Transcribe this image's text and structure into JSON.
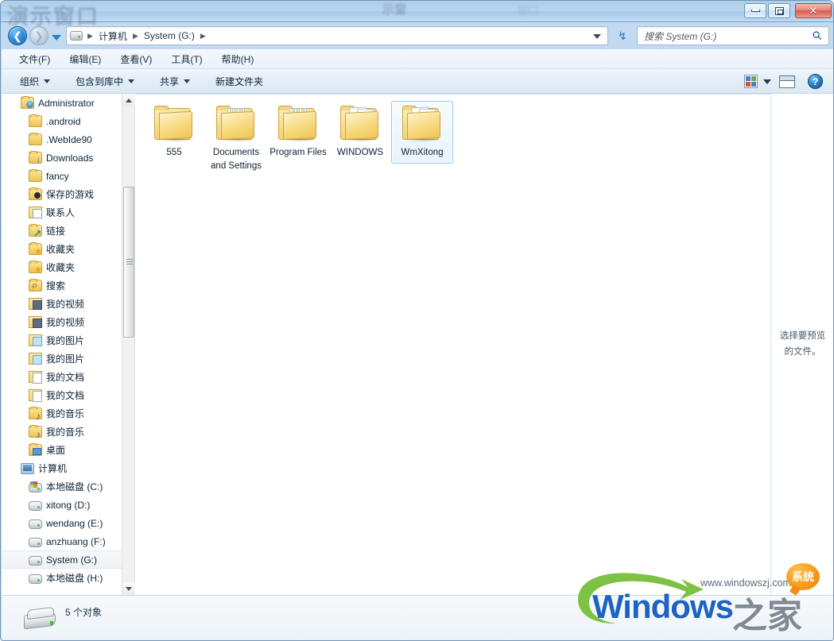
{
  "window": {
    "title_ghost": "演示窗口",
    "title_ghost_2": "示窗",
    "title_ghost_3": "窗口",
    "controls": {
      "minimize": "minimize-icon",
      "maximize": "restore-icon",
      "close": "✕"
    }
  },
  "address": {
    "back_label": "❮",
    "forward_label": "❯",
    "drive_icon": "drive-icon",
    "breadcrumbs": [
      "计算机",
      "System (G:)"
    ],
    "separator": "▶",
    "dropdown_icon": "chevron-down-icon",
    "refresh_icon": "↯"
  },
  "search": {
    "placeholder": "搜索 System (G:)",
    "value": "",
    "icon": "search-icon"
  },
  "menu": {
    "items": [
      {
        "label": "文件(F)",
        "mnemonic": "F"
      },
      {
        "label": "编辑(E)",
        "mnemonic": "E"
      },
      {
        "label": "查看(V)",
        "mnemonic": "V"
      },
      {
        "label": "工具(T)",
        "mnemonic": "T"
      },
      {
        "label": "帮助(H)",
        "mnemonic": "H"
      }
    ]
  },
  "toolbar": {
    "items": [
      {
        "label": "组织",
        "has_caret": true
      },
      {
        "label": "包含到库中",
        "has_caret": true
      },
      {
        "label": "共享",
        "has_caret": true
      },
      {
        "label": "新建文件夹",
        "has_caret": false
      }
    ],
    "view_icon": "view-options-icon",
    "view_caret": "chevron-down-icon",
    "preview_toggle_icon": "preview-pane-icon",
    "help_icon": "help-icon",
    "help_label": "?"
  },
  "sidebar": {
    "items": [
      {
        "label": "Administrator",
        "icon": "user-folder-icon",
        "indent": 1,
        "selected": false
      },
      {
        "label": ".android",
        "icon": "folder-icon",
        "indent": 2,
        "selected": false
      },
      {
        "label": ".WebIde90",
        "icon": "folder-icon",
        "indent": 2,
        "selected": false
      },
      {
        "label": "Downloads",
        "icon": "downloads-folder-icon",
        "indent": 2,
        "selected": false
      },
      {
        "label": "fancy",
        "icon": "folder-icon",
        "indent": 2,
        "selected": false
      },
      {
        "label": "保存的游戏",
        "icon": "saved-games-folder-icon",
        "indent": 2,
        "selected": false
      },
      {
        "label": "联系人",
        "icon": "contacts-folder-icon",
        "indent": 2,
        "selected": false
      },
      {
        "label": "链接",
        "icon": "links-folder-icon",
        "indent": 2,
        "selected": false
      },
      {
        "label": "收藏夹",
        "icon": "favorites-folder-icon",
        "indent": 2,
        "selected": false
      },
      {
        "label": "收藏夹",
        "icon": "favorites-folder-icon",
        "indent": 2,
        "selected": false
      },
      {
        "label": "搜索",
        "icon": "searches-folder-icon",
        "indent": 2,
        "selected": false
      },
      {
        "label": "我的视频",
        "icon": "videos-folder-icon",
        "indent": 2,
        "selected": false
      },
      {
        "label": "我的视频",
        "icon": "videos-folder-icon",
        "indent": 2,
        "selected": false
      },
      {
        "label": "我的图片",
        "icon": "pictures-folder-icon",
        "indent": 2,
        "selected": false
      },
      {
        "label": "我的图片",
        "icon": "pictures-folder-icon",
        "indent": 2,
        "selected": false
      },
      {
        "label": "我的文档",
        "icon": "documents-folder-icon",
        "indent": 2,
        "selected": false
      },
      {
        "label": "我的文档",
        "icon": "documents-folder-icon",
        "indent": 2,
        "selected": false
      },
      {
        "label": "我的音乐",
        "icon": "music-folder-icon",
        "indent": 2,
        "selected": false
      },
      {
        "label": "我的音乐",
        "icon": "music-folder-icon",
        "indent": 2,
        "selected": false
      },
      {
        "label": "桌面",
        "icon": "desktop-folder-icon",
        "indent": 2,
        "selected": false
      },
      {
        "label": "计算机",
        "icon": "computer-icon",
        "indent": 1,
        "selected": false
      },
      {
        "label": "本地磁盘 (C:)",
        "icon": "windows-drive-icon",
        "indent": 2,
        "selected": false
      },
      {
        "label": "xitong (D:)",
        "icon": "drive-icon",
        "indent": 2,
        "selected": false
      },
      {
        "label": "wendang (E:)",
        "icon": "drive-icon",
        "indent": 2,
        "selected": false
      },
      {
        "label": "anzhuang (F:)",
        "icon": "drive-icon",
        "indent": 2,
        "selected": false
      },
      {
        "label": "System (G:)",
        "icon": "drive-icon",
        "indent": 2,
        "selected": true
      },
      {
        "label": "本地磁盘 (H:)",
        "icon": "drive-icon",
        "indent": 2,
        "selected": false
      }
    ],
    "scrollbar": {
      "up_arrow": "scroll-up-icon",
      "down_arrow": "scroll-down-icon"
    }
  },
  "files": {
    "items": [
      {
        "name": "555",
        "icon": "folder-icon",
        "type": "empty",
        "selected": false
      },
      {
        "name": "Documents and Settings",
        "icon": "folder-icon",
        "type": "tabs",
        "selected": false
      },
      {
        "name": "Program Files",
        "icon": "folder-icon",
        "type": "tabs",
        "selected": false
      },
      {
        "name": "WINDOWS",
        "icon": "folder-icon",
        "type": "papers",
        "selected": false
      },
      {
        "name": "WmXitong",
        "icon": "folder-icon",
        "type": "papers",
        "selected": true
      }
    ]
  },
  "preview": {
    "message": "选择要预览的文件。"
  },
  "status": {
    "drive_icon": "hard-drive-icon",
    "text": "5 个对象"
  },
  "watermark": {
    "url": "www.windowszj.com",
    "brand_en": "Windows",
    "brand_cn": "之家",
    "badge": "系统"
  }
}
